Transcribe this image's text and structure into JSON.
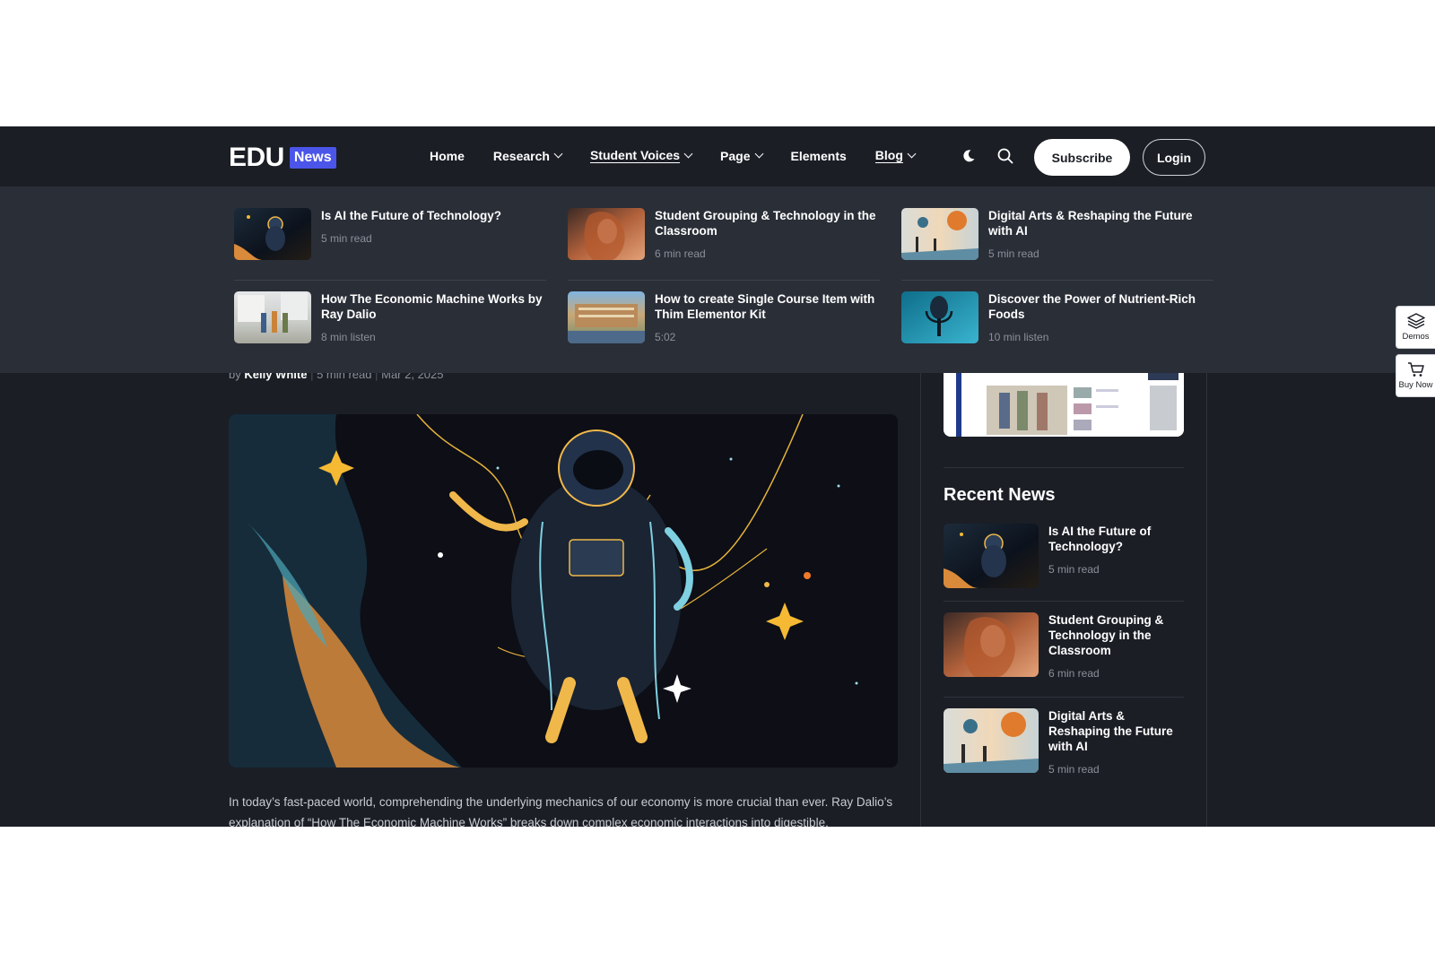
{
  "header": {
    "logo_main": "EDU",
    "logo_badge": "News",
    "nav": [
      {
        "label": "Home"
      },
      {
        "label": "Research"
      },
      {
        "label": "Student Voices"
      },
      {
        "label": "Page"
      },
      {
        "label": "Elements"
      },
      {
        "label": "Blog"
      }
    ],
    "subscribe_label": "Subscribe",
    "login_label": "Login",
    "moon_icon": "moon-icon",
    "search_icon": "search-icon"
  },
  "mega_menu": {
    "items": [
      {
        "title": "Is AI the Future of Technology?",
        "meta": "5 min read"
      },
      {
        "title": "Student Grouping & Technology in the Classroom",
        "meta": "6 min read"
      },
      {
        "title": "Digital Arts & Reshaping the Future with AI",
        "meta": "5 min read"
      },
      {
        "title": "How The Economic Machine Works by Ray Dalio",
        "meta": "8 min listen"
      },
      {
        "title": "How to create Single Course Item with Thim Elementor Kit",
        "meta": "5:02"
      },
      {
        "title": "Discover the Power of Nutrient-Rich Foods",
        "meta": "10 min listen"
      }
    ]
  },
  "article": {
    "by": "by",
    "author": "Kelly White",
    "read_time": "5 min read",
    "date": "Mar 2, 2025",
    "body": "In today’s fast-paced world, comprehending the underlying mechanics of our economy is more crucial than ever. Ray Dalio’s explanation of “How The Economic Machine Works” breaks down complex economic interactions into digestible,"
  },
  "sidebar": {
    "recent_title": "Recent News",
    "recent": [
      {
        "title": "Is AI the Future of Technology?",
        "meta": "5 min read"
      },
      {
        "title": "Student Grouping & Technology in the Classroom",
        "meta": "6 min read"
      },
      {
        "title": "Digital Arts & Reshaping the Future with AI",
        "meta": "5 min read"
      }
    ]
  },
  "side_tabs": {
    "demos_label": "Demos",
    "buy_label": "Buy Now"
  },
  "colors": {
    "background": "#1b1e25",
    "mega_menu": "#2a2e37",
    "accent": "#4b55e9",
    "progress": "#6b74e6"
  }
}
